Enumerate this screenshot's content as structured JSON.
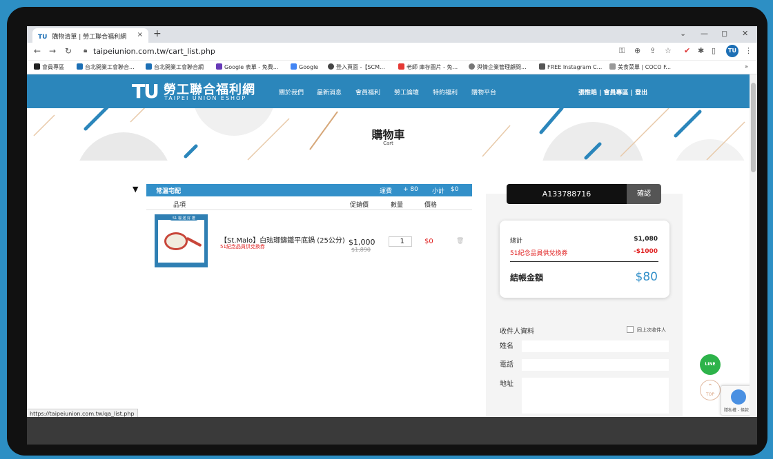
{
  "browser": {
    "tab_title": "購物清單 | 勞工聯合福利網",
    "tab_favicon": "TU",
    "close_tab": "×",
    "new_tab": "+",
    "url": "taipeiunion.com.tw/cart_list.php",
    "profile_initial": "TU",
    "bookmarks": [
      "會員專區",
      "台北開業工會聯合...",
      "台北開業工會聯合網",
      "Google 表單 - 免費...",
      "Google",
      "登入頁面 -【SCM...",
      "老師 庫存圖片 - 免...",
      "與情企業管理顧問...",
      "FREE Instagram C...",
      "美食菜單 | COCO F..."
    ],
    "bookmarks_more": "»",
    "status_url": "https://taipeiunion.com.tw/qa_list.php"
  },
  "site": {
    "logo_mark": "TU",
    "logo_name": "勞工聯合福利網",
    "logo_sub": "TAIPEI UNION ESHOP",
    "menu": [
      "關於我們",
      "最新消息",
      "會員福利",
      "勞工論壇",
      "特約福利",
      "購物平台"
    ],
    "user_links": "張惟皓 | 會員專區 | 登出"
  },
  "banner": {
    "title": "購物車",
    "subtitle": "Cart"
  },
  "cart": {
    "section_title": "常溫宅配",
    "shipping_label": "運費",
    "shipping_value": "+ 80",
    "subtotal_label": "小計",
    "subtotal_value": "$0",
    "columns": [
      "品項",
      "促銷價",
      "數量",
      "價格"
    ],
    "item": {
      "image_tag": "51 檔 送 好 禮",
      "name": "【St.Malo】白珐瑯鑄鐵平底鍋 (25公分)",
      "note": "51紀念品員供兌換券",
      "promo_price": "$1,000",
      "original_price": "$1,890",
      "quantity": "1",
      "price": "$0"
    }
  },
  "coupon": {
    "code": "A133788716",
    "button": "確認"
  },
  "summary": {
    "total_label": "總計",
    "total_value": "$1,080",
    "discount_label": "51紀念品員供兌換券",
    "discount_value": "-$1000",
    "checkout_label": "結帳金額",
    "checkout_value": "$80"
  },
  "recipient": {
    "title": "收件人資料",
    "same_as_label": "同上次收件人",
    "fields": [
      "姓名",
      "電話",
      "地址"
    ]
  },
  "floating": {
    "line": "LINE",
    "top": "TOP",
    "recaptcha": "隱私權 - 條款"
  },
  "colors": {
    "brand_blue": "#2b86bb",
    "accent_blue": "#3390c9",
    "alert_red": "#e02020",
    "line_green": "#2db34a"
  }
}
